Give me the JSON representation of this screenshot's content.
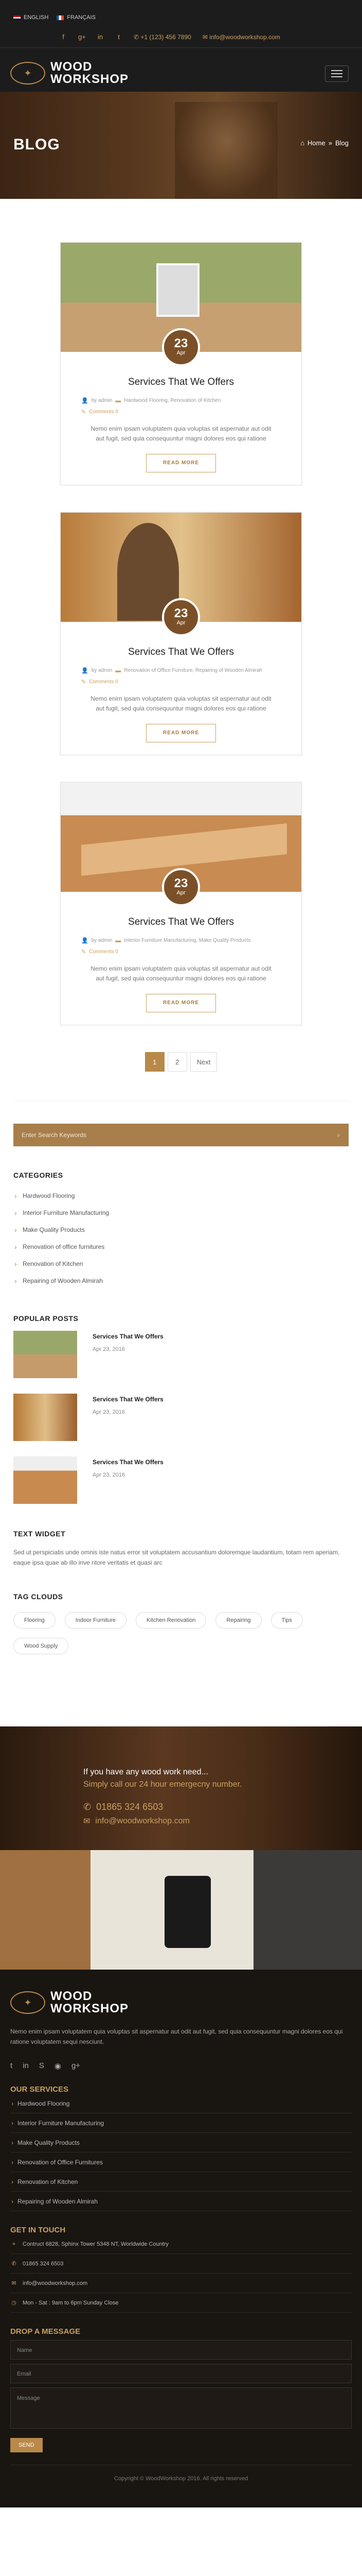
{
  "header": {
    "languages": [
      "ENGLISH",
      "FRANÇAIS"
    ],
    "phone": "+1 (123) 456 7890",
    "email": "info@woodworkshop.com",
    "logo_line1": "WOOD",
    "logo_line2": "WORKSHOP"
  },
  "banner": {
    "title": "BLOG",
    "crumb_home": "Home",
    "crumb_sep": "»",
    "crumb_current": "Blog"
  },
  "posts": [
    {
      "day": "23",
      "month": "Apr",
      "title": "Services That We Offers",
      "author": "by admin",
      "categories": "Hardwood Flooring, Renovation of Kitchen",
      "comments": "Comments 0",
      "excerpt": "Nemo enim ipsam voluptatem quia voluptas sit aspernatur aut odit aut fugit, sed quia consequuntur magni dolores eos qui ratione",
      "read_more": "READ MORE"
    },
    {
      "day": "23",
      "month": "Apr",
      "title": "Services That We Offers",
      "author": "by admin",
      "categories": "Renovation of Office Furniture, Repairing of Wooden Almirah",
      "comments": "Comments 0",
      "excerpt": "Nemo enim ipsam voluptatem quia voluptas sit aspernatur aut odit aut fugit, sed quia consequuntur magni dolores eos qui ratione",
      "read_more": "READ MORE"
    },
    {
      "day": "23",
      "month": "Apr",
      "title": "Services That We Offers",
      "author": "by admin",
      "categories": "Interior Furniture Manufacturing, Make Quality Products",
      "comments": "Comments 0",
      "excerpt": "Nemo enim ipsam voluptatem quia voluptas sit aspernatur aut odit aut fugit, sed quia consequuntur magni dolores eos qui ratione",
      "read_more": "READ MORE"
    }
  ],
  "pagination": {
    "p1": "1",
    "p2": "2",
    "next": "Next"
  },
  "sidebar": {
    "search_placeholder": "Enter Search Keywords",
    "categories_title": "CATEGORIES",
    "categories": [
      "Hardwood Flooring",
      "Interior Furniture Manufacturing",
      "Make Quality Products",
      "Renovation of office furnitures",
      "Renovation of Kitchen",
      "Repairing of Wooden Almirah"
    ],
    "popular_title": "POPULAR POSTS",
    "popular": [
      {
        "title": "Services That We Offers",
        "date": "Apr 23, 2016"
      },
      {
        "title": "Services That We Offers",
        "date": "Apr 23, 2016"
      },
      {
        "title": "Services That We Offers",
        "date": "Apr 23, 2016"
      }
    ],
    "text_widget_title": "TEXT WIDGET",
    "text_widget": "Sed ut perspiciatis unde omnis iste natus error sit voluptatem accusantium doloremque laudantium, totam rem aperiam, eaque ipsa quae ab illo inve ntore veritatis et quasi arc",
    "tags_title": "TAG CLOUDS",
    "tags": [
      "Flooring",
      "Indoor Furniture",
      "Kitchen Renovation",
      "Repairing",
      "Tips",
      "Wood Supply"
    ]
  },
  "call": {
    "line1": "If you have any wood work need...",
    "line2": "Simply call our 24 hour emergecny number.",
    "phone": "01865 324 6503",
    "email": "info@woodworkshop.com"
  },
  "footer": {
    "logo_line1": "WOOD",
    "logo_line2": "WORKSHOP",
    "about": "Nemo enim ipsam voluptatem quia voluptas sit aspernatur aut odit aut fugit, sed quia consequuntur magni dolores eos qui ratione voluptatem sequi nesciunt.",
    "services_title": "OUR SERVICES",
    "services": [
      "Hardwood Flooring",
      "Interior Furniture Manufacturing",
      "Make Quality Products",
      "Renovation of Office Furnitures",
      "Renovation of Kitchen",
      "Repairing of Wooden Almirah"
    ],
    "touch_title": "GET IN TOUCH",
    "address": "Contruct 6828, Sphinx Tower 5348 NT, Worldwide Country",
    "phone": "01865 324 6503",
    "email": "info@woodworkshop.com",
    "hours": "Mon - Sat : 9am to 6pm Sunday Close",
    "form_title": "DROP A MESSAGE",
    "name_ph": "Name",
    "email_ph": "Email",
    "message_ph": "Message",
    "send": "SEND",
    "copyright": "Copyright © WoodWorkshop 2016. All rights reserved"
  }
}
